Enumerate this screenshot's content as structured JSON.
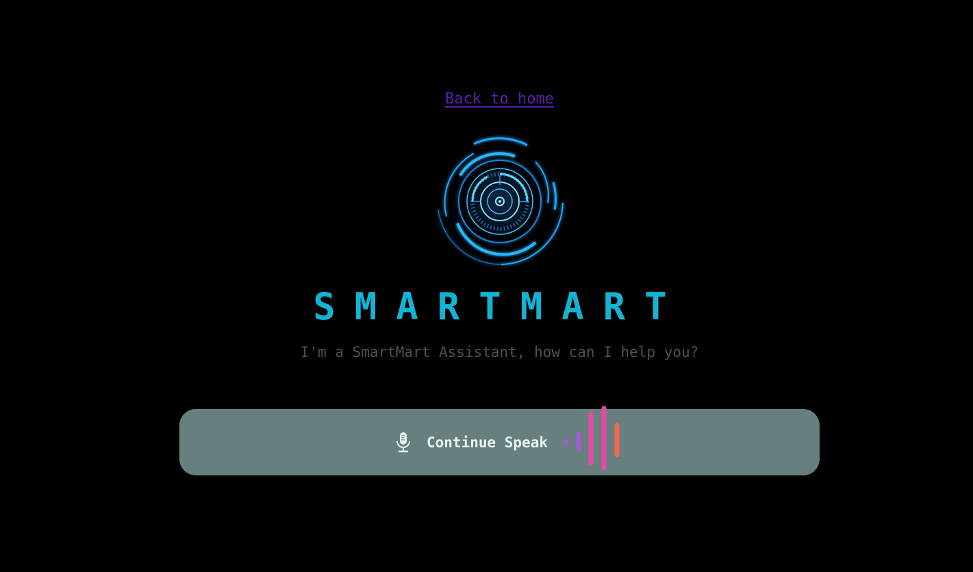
{
  "nav": {
    "back_link": "Back to home"
  },
  "hero": {
    "title": "SMARTMART",
    "subtitle": "I'm a SmartMart Assistant, how can I help you?"
  },
  "speak": {
    "label": "Continue Speak",
    "icon": "microphone-icon"
  },
  "colors": {
    "background": "#000000",
    "link": "#5c1fb0",
    "title": "#12b4d4",
    "subtitle": "#475457",
    "speak_bar": "#687f7f",
    "speak_text": "#e6f2f2",
    "logo_glow": "#1ea7ff",
    "wave_purple": "#a35bd6",
    "wave_pink": "#e64aa6",
    "wave_orange": "#f2694f"
  }
}
